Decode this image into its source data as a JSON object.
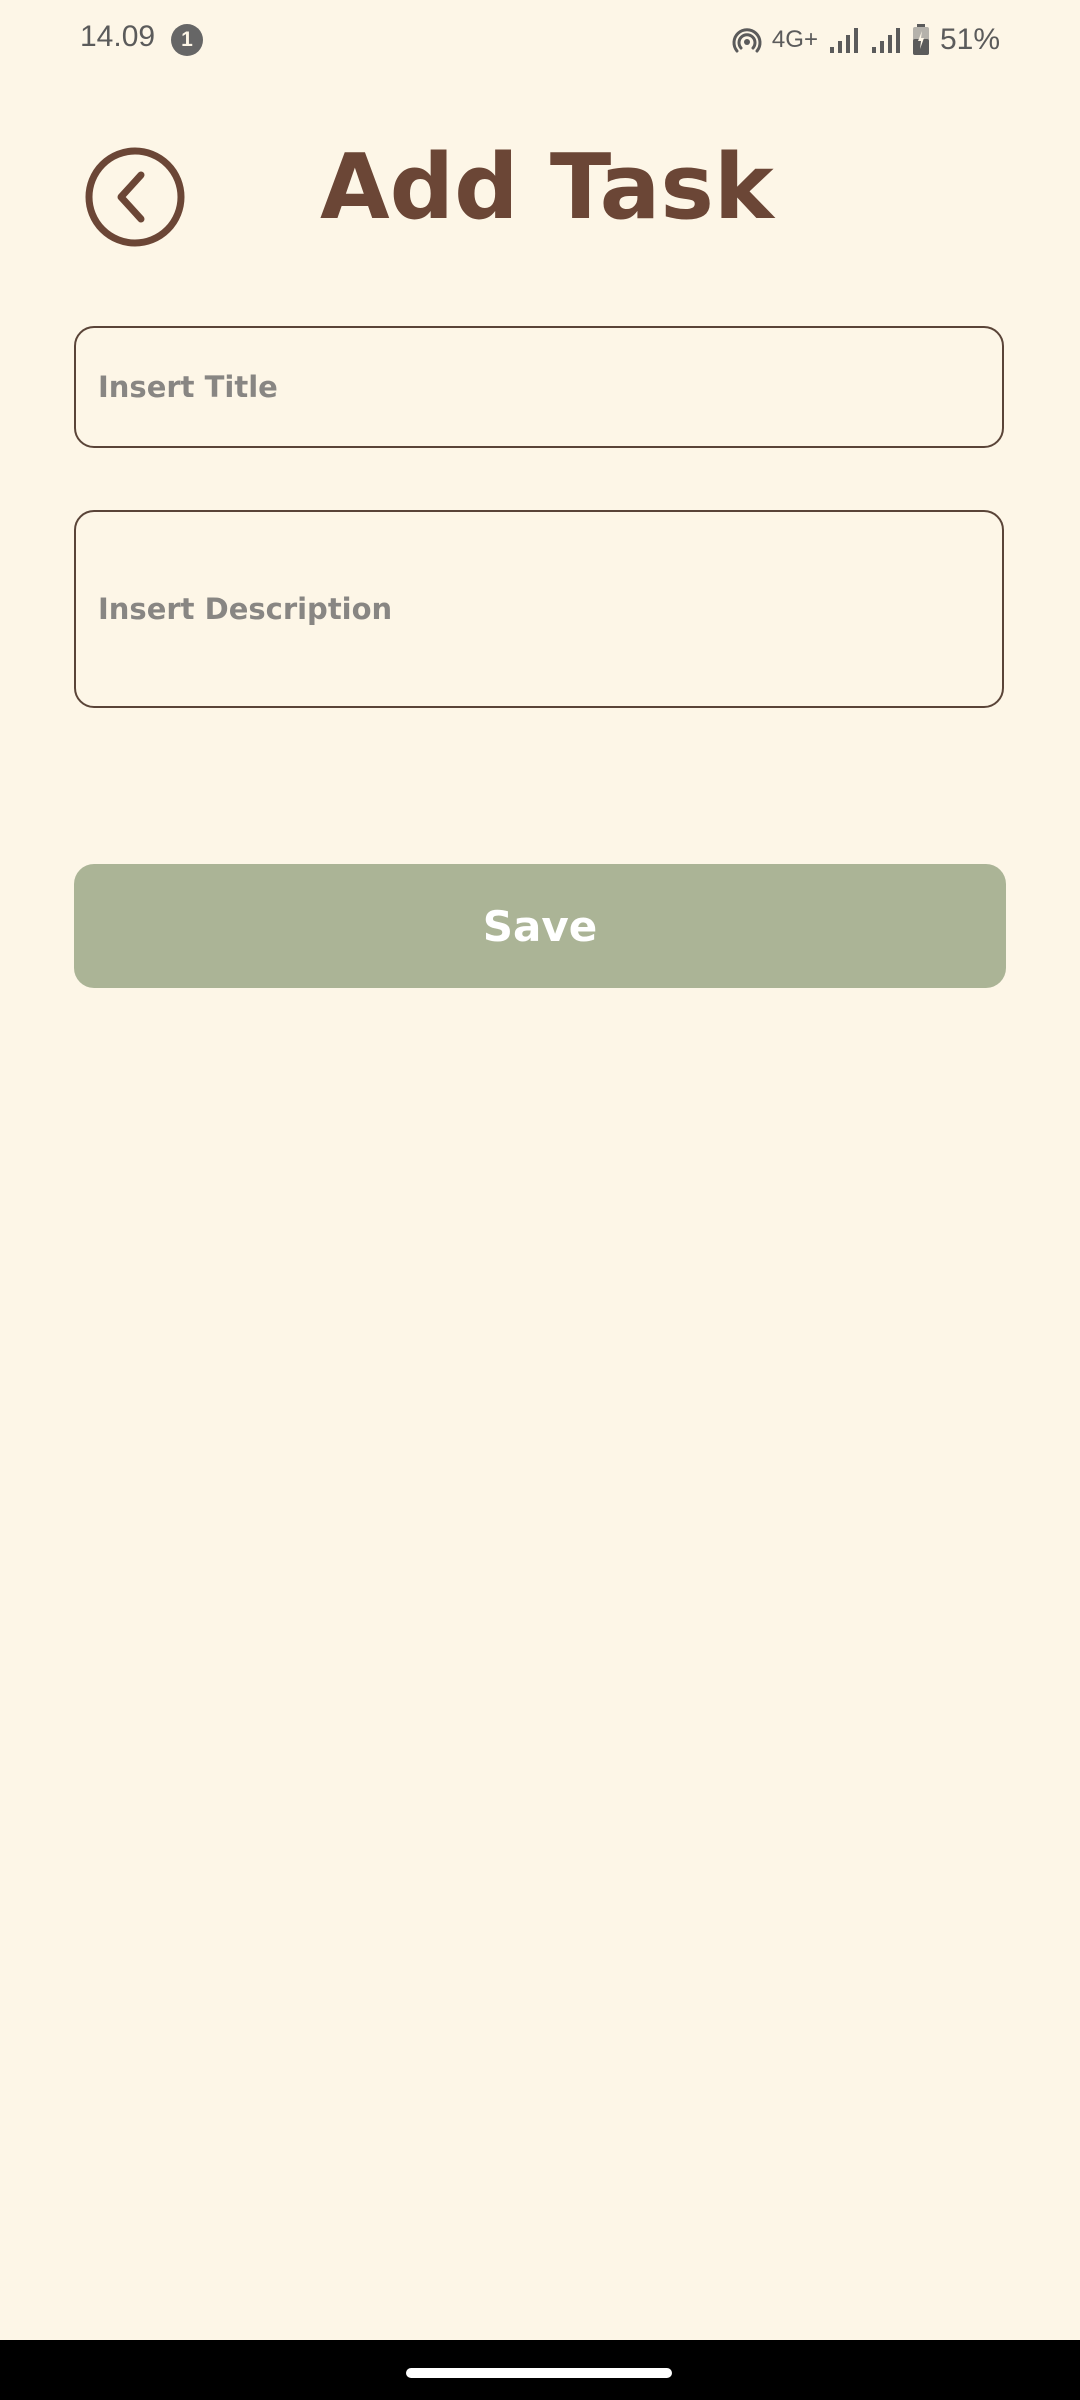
{
  "status_bar": {
    "time": "14.09",
    "notification_count": "1",
    "network_type": "4G+",
    "battery": "51%"
  },
  "header": {
    "title": "Add Task",
    "back_icon": "chevron-left-circle-icon"
  },
  "form": {
    "title_placeholder": "Insert Title",
    "title_value": "",
    "description_placeholder": "Insert Description",
    "description_value": "",
    "save_label": "Save"
  },
  "colors": {
    "background": "#fdf6e7",
    "title": "#6b4636",
    "field_border": "#5a4438",
    "placeholder": "#888683",
    "save_button": "#abb496",
    "save_text": "#ffffff"
  },
  "icons": {
    "hotspot": "hotspot-icon",
    "signal_1": "signal-icon",
    "signal_2": "signal-icon",
    "battery": "battery-icon"
  }
}
